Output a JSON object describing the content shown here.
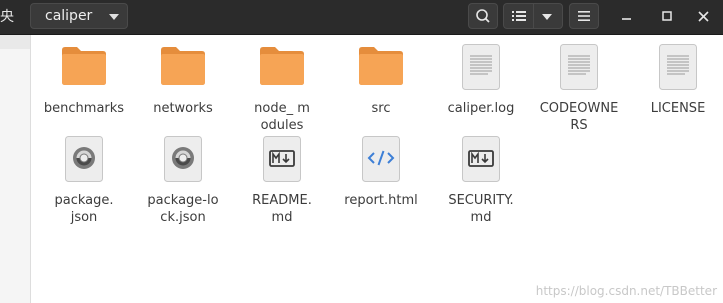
{
  "header": {
    "left_text": "央",
    "path_label": "caliper",
    "icons": [
      "search-icon",
      "list-view-icon",
      "chevron-down-icon",
      "hamburger-menu-icon",
      "minimize-icon",
      "maximize-icon",
      "close-icon"
    ]
  },
  "files": [
    {
      "name": "benchmarks",
      "type": "folder"
    },
    {
      "name": "networks",
      "type": "folder"
    },
    {
      "name": "node_ modules",
      "type": "folder"
    },
    {
      "name": "src",
      "type": "folder"
    },
    {
      "name": "caliper.log",
      "type": "text-file"
    },
    {
      "name": "CODEOWNERS",
      "type": "text-file"
    },
    {
      "name": "LICENSE",
      "type": "text-file"
    },
    {
      "name": "package. json",
      "type": "json-file"
    },
    {
      "name": "package-lock.json",
      "type": "json-file"
    },
    {
      "name": "README. md",
      "type": "markdown-file"
    },
    {
      "name": "report.html",
      "type": "html-file"
    },
    {
      "name": "SECURITY. md",
      "type": "markdown-file"
    }
  ],
  "watermark": "https://blog.csdn.net/TBBetter",
  "colors": {
    "header_bg": "#2b2b2b",
    "folder": "#f4a04d",
    "folder_light": "#f9b46a"
  }
}
